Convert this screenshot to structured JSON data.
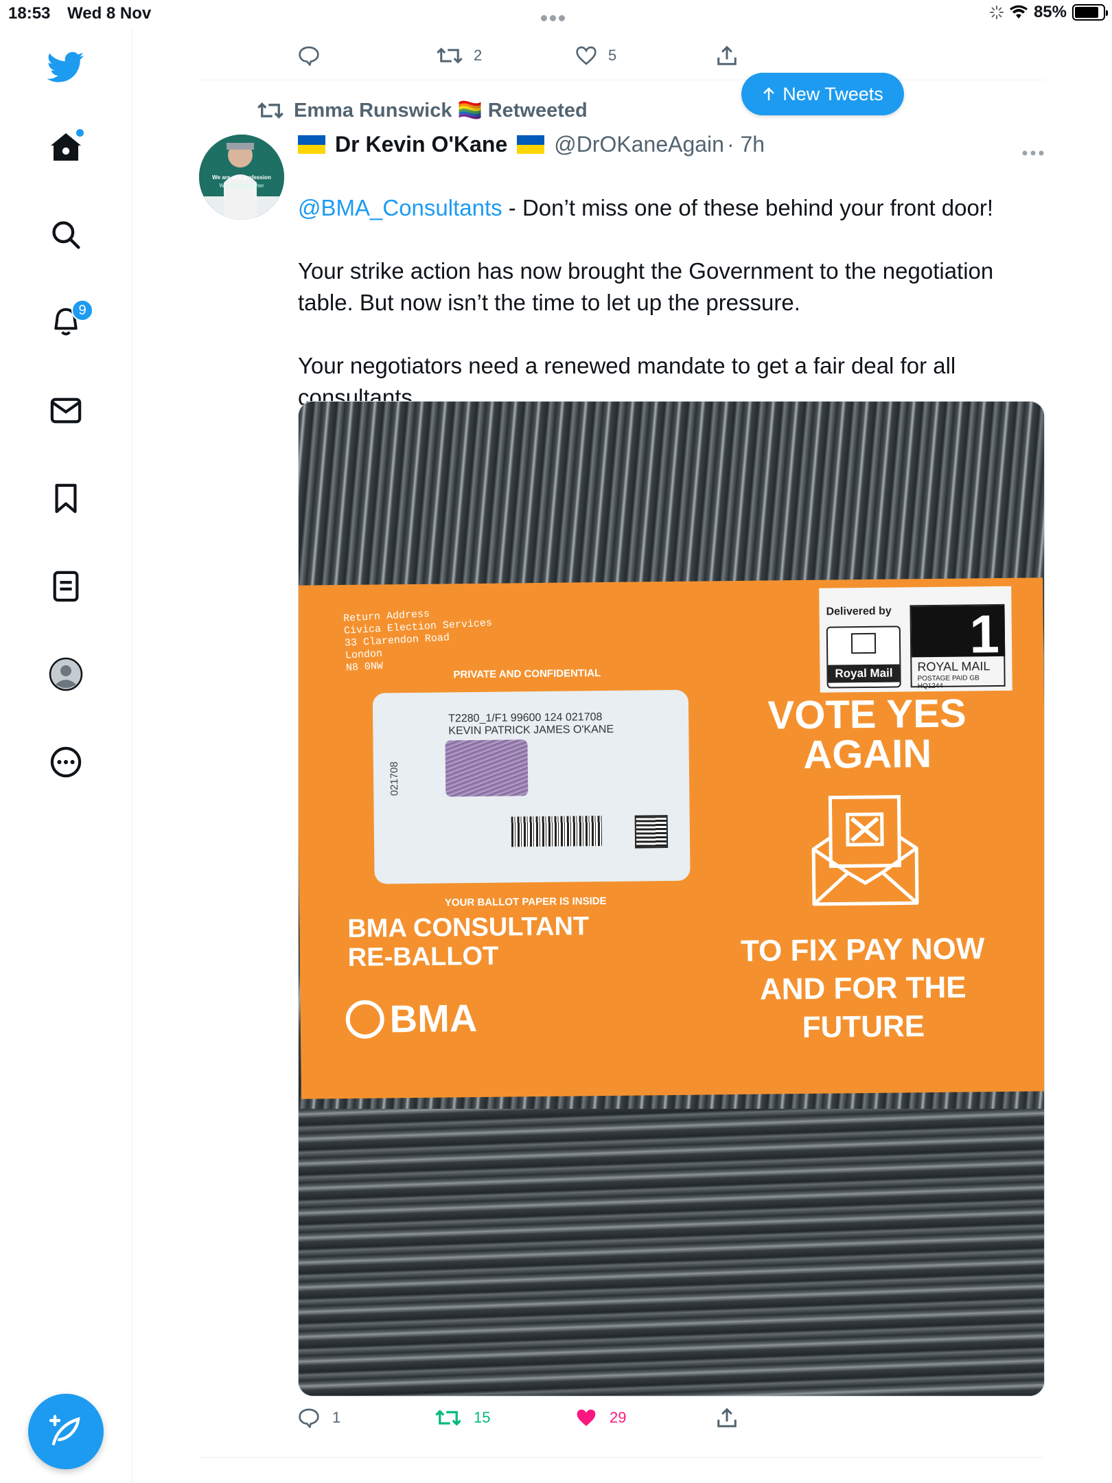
{
  "status_bar": {
    "time": "18:53",
    "date": "Wed 8 Nov",
    "battery": "85%",
    "battery_level": 0.85
  },
  "sidebar": {
    "notifications_badge": "9"
  },
  "prev_tweet": {
    "retweets": "2",
    "likes": "5"
  },
  "new_tweets_label": "New Tweets",
  "tweet": {
    "retweeted_by": "Emma Runswick 🏳️‍🌈 Retweeted",
    "author_name": "Dr Kevin O'Kane",
    "author_handle": "@DrOKaneAgain",
    "time_ago": "· 7h",
    "mention": "@BMA_Consultants",
    "text_after_mention": " - Don’t miss one of these behind your front door!\n\nYour strike action has now brought the Government to the negotiation table. But now isn’t the time to let up the pressure.\n\nYour negotiators need a renewed mandate to get a fair deal for all consultants.",
    "avatar_text_1": "We are one profession",
    "avatar_text_2": "We stand together",
    "replies": "1",
    "retweets": "15",
    "likes": "29"
  },
  "envelope": {
    "return_address": "Return Address\nCivica Election Services\n33 Clarendon Road\nLondon\nN8 0NW",
    "private": "PRIVATE AND CONFIDENTIAL",
    "delivered_by": "Delivered by",
    "royal_mail_logo": "Royal Mail",
    "stamp_number": "1",
    "stamp_royal_mail": "ROYAL MAIL",
    "stamp_postage": "POSTAGE PAID GB\nHQ1244",
    "window_side_number": "021708",
    "window_address": "T2280_1/F1 99600 124 021708\nKEVIN PATRICK JAMES O'KANE",
    "ballot_inside": "YOUR BALLOT PAPER IS INSIDE",
    "ballot_title": "BMA CONSULTANT\nRE-BALLOT",
    "bma_logo_text": "BMA",
    "vote_yes": "VOTE YES\nAGAIN",
    "fix_pay": "TO FIX PAY NOW\nAND FOR THE\nFUTURE"
  },
  "colors": {
    "twitter_blue": "#1d9bf0",
    "retweet_green": "#00ba7c",
    "like_pink": "#f91880",
    "envelope_orange": "#f4912e",
    "muted_text": "#536471"
  }
}
